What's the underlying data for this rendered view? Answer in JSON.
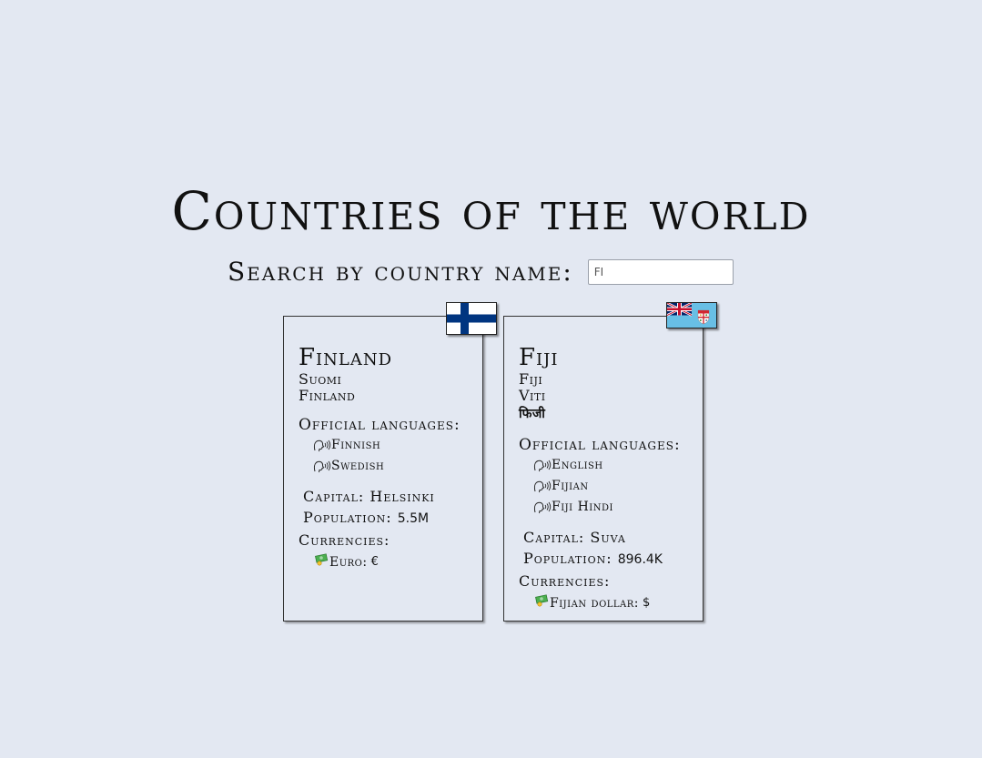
{
  "title": "Countries of the world",
  "search": {
    "label": "Search by country name:",
    "value": "FI"
  },
  "countries": [
    {
      "name": "Finland",
      "native_names": [
        "Suomi",
        "Finland"
      ],
      "languages_label": "Official languages:",
      "languages": [
        "Finnish",
        "Swedish"
      ],
      "capital_label": "Capital:",
      "capital": "Helsinki",
      "population_label": "Population:",
      "population": "5.5M",
      "currencies_label": "Currencies:",
      "currencies": [
        {
          "name": "Euro:",
          "symbol": "€"
        }
      ],
      "flag_icon": "finland-flag-icon"
    },
    {
      "name": "Fiji",
      "native_names": [
        "Fiji",
        "Viti",
        "फिजी"
      ],
      "languages_label": "Official languages:",
      "languages": [
        "English",
        "Fijian",
        "Fiji Hindi"
      ],
      "capital_label": "Capital:",
      "capital": "Suva",
      "population_label": "Population:",
      "population": "896.4K",
      "currencies_label": "Currencies:",
      "currencies": [
        {
          "name": "Fijian dollar:",
          "symbol": "$"
        }
      ],
      "flag_icon": "fiji-flag-icon"
    }
  ],
  "colors": {
    "background": "#e3e8f2",
    "finland_blue": "#003580",
    "fiji_blue": "#68bfe5"
  }
}
